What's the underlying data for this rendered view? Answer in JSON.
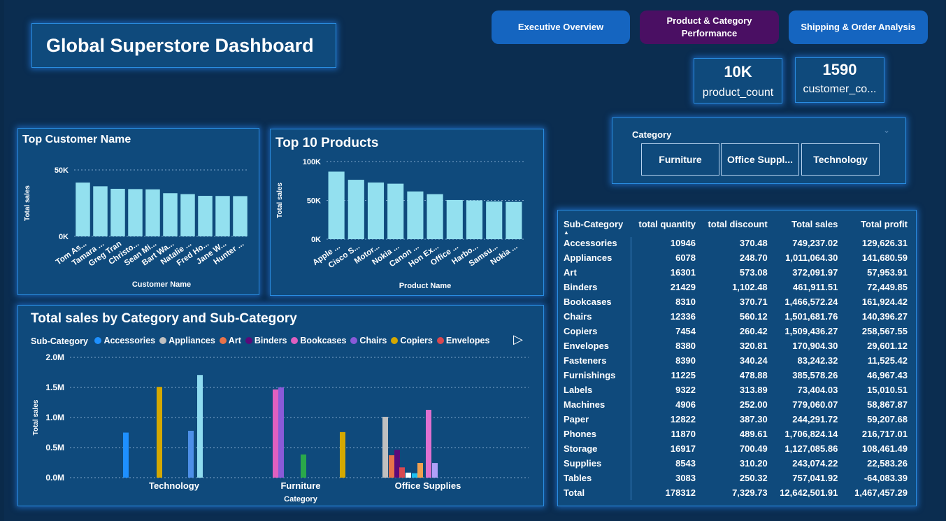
{
  "dashboard_title": "Global Superstore Dashboard",
  "nav": [
    {
      "label": "Executive Overview",
      "color": "#1565c0"
    },
    {
      "label": "Product & Category Performance",
      "color": "#4a0f63"
    },
    {
      "label": "Shipping & Order Analysis",
      "color": "#1565c0"
    }
  ],
  "kpis": {
    "product_count": {
      "value": "10K",
      "label": "product_count"
    },
    "customer_count": {
      "value": "1590",
      "label": "customer_co..."
    }
  },
  "slicer": {
    "label": "Category",
    "options": [
      "Furniture",
      "Office Suppl...",
      "Technology"
    ]
  },
  "top_customers": {
    "title": "Top Customer Name",
    "xlabel": "Customer Name",
    "ylabel": "Total sales",
    "ticks": [
      "50K",
      "0K"
    ],
    "chart_data": {
      "type": "bar",
      "categories": [
        "Tom As...",
        "Tamara ...",
        "Greg Tran",
        "Christo...",
        "Sean Mi...",
        "Bart Wa...",
        "Natalie ...",
        "Fred Ho...",
        "Jane W...",
        "Hunter ..."
      ],
      "values": [
        40500,
        37700,
        35800,
        35600,
        35400,
        32500,
        31800,
        30500,
        30400,
        30300
      ],
      "ylim": [
        0,
        50000
      ]
    }
  },
  "top_products": {
    "title": "Top 10 Products",
    "xlabel": "Product Name",
    "ylabel": "Total sales",
    "ticks": [
      "100K",
      "50K",
      "0K"
    ],
    "chart_data": {
      "type": "bar",
      "categories": [
        "Apple ...",
        "Cisco S...",
        "Motor...",
        "Nokia ...",
        "Canon ...",
        "Hon Ex...",
        "Office ...",
        "Harbo...",
        "Samsu...",
        "Nokia ..."
      ],
      "values": [
        87000,
        76500,
        73000,
        71500,
        61500,
        58000,
        50500,
        50000,
        48500,
        48000
      ],
      "ylim": [
        0,
        100000
      ]
    }
  },
  "category_chart": {
    "title": "Total sales by Category and Sub-Category",
    "legend_title": "Sub-Category",
    "legend": [
      {
        "name": "Accessories",
        "color": "#1e90ff"
      },
      {
        "name": "Appliances",
        "color": "#c0c0c0"
      },
      {
        "name": "Art",
        "color": "#e8734a"
      },
      {
        "name": "Binders",
        "color": "#5b0a7a"
      },
      {
        "name": "Bookcases",
        "color": "#e060c0"
      },
      {
        "name": "Chairs",
        "color": "#8a5ad8"
      },
      {
        "name": "Copiers",
        "color": "#d4a800"
      },
      {
        "name": "Envelopes",
        "color": "#d84850"
      }
    ],
    "xlabel": "Category",
    "ylabel": "Total sales",
    "ticks": [
      "2.0M",
      "1.5M",
      "1.0M",
      "0.5M",
      "0.0M"
    ],
    "chart_data": {
      "type": "bar",
      "categories": [
        "Technology",
        "Furniture",
        "Office Supplies"
      ],
      "ylim": [
        0,
        2000000
      ],
      "series": [
        {
          "category": "Technology",
          "bars": [
            {
              "sub": "Accessories",
              "value": 749237,
              "color": "#1e90ff"
            },
            {
              "sub": "Copiers",
              "value": 1509436,
              "color": "#d4a800"
            },
            {
              "sub": "Machines",
              "value": 779060,
              "color": "#4d8fe8"
            },
            {
              "sub": "Phones",
              "value": 1706824,
              "color": "#8fdcf0"
            }
          ]
        },
        {
          "category": "Furniture",
          "bars": [
            {
              "sub": "Bookcases",
              "value": 1466572,
              "color": "#e060c0"
            },
            {
              "sub": "Chairs",
              "value": 1501682,
              "color": "#8a5ad8"
            },
            {
              "sub": "Furnishings",
              "value": 385578,
              "color": "#2aa84a"
            },
            {
              "sub": "Tables",
              "value": 757042,
              "color": "#d4a800"
            }
          ]
        },
        {
          "category": "Office Supplies",
          "bars": [
            {
              "sub": "Appliances",
              "value": 1011064,
              "color": "#c0c0c0"
            },
            {
              "sub": "Art",
              "value": 372092,
              "color": "#e8734a"
            },
            {
              "sub": "Binders",
              "value": 461912,
              "color": "#5b0a7a"
            },
            {
              "sub": "Envelopes",
              "value": 170904,
              "color": "#d84850"
            },
            {
              "sub": "Fasteners",
              "value": 83242,
              "color": "#ffffff"
            },
            {
              "sub": "Labels",
              "value": 73404,
              "color": "#1ec0f0"
            },
            {
              "sub": "Paper",
              "value": 244292,
              "color": "#f0a050"
            },
            {
              "sub": "Storage",
              "value": 1127086,
              "color": "#e070d0"
            },
            {
              "sub": "Supplies",
              "value": 243074,
              "color": "#b0a0f8"
            }
          ]
        }
      ]
    }
  },
  "table": {
    "columns": [
      "Sub-Category",
      "total quantity",
      "total discount",
      "Total sales",
      "Total profit"
    ],
    "rows": [
      [
        "Accessories",
        "10946",
        "370.48",
        "749,237.02",
        "129,626.31"
      ],
      [
        "Appliances",
        "6078",
        "248.70",
        "1,011,064.30",
        "141,680.59"
      ],
      [
        "Art",
        "16301",
        "573.08",
        "372,091.97",
        "57,953.91"
      ],
      [
        "Binders",
        "21429",
        "1,102.48",
        "461,911.51",
        "72,449.85"
      ],
      [
        "Bookcases",
        "8310",
        "370.71",
        "1,466,572.24",
        "161,924.42"
      ],
      [
        "Chairs",
        "12336",
        "560.12",
        "1,501,681.76",
        "140,396.27"
      ],
      [
        "Copiers",
        "7454",
        "260.42",
        "1,509,436.27",
        "258,567.55"
      ],
      [
        "Envelopes",
        "8380",
        "320.81",
        "170,904.30",
        "29,601.12"
      ],
      [
        "Fasteners",
        "8390",
        "340.24",
        "83,242.32",
        "11,525.42"
      ],
      [
        "Furnishings",
        "11225",
        "478.88",
        "385,578.26",
        "46,967.43"
      ],
      [
        "Labels",
        "9322",
        "313.89",
        "73,404.03",
        "15,010.51"
      ],
      [
        "Machines",
        "4906",
        "252.00",
        "779,060.07",
        "58,867.87"
      ],
      [
        "Paper",
        "12822",
        "387.30",
        "244,291.72",
        "59,207.68"
      ],
      [
        "Phones",
        "11870",
        "489.61",
        "1,706,824.14",
        "216,717.01"
      ],
      [
        "Storage",
        "16917",
        "700.49",
        "1,127,085.86",
        "108,461.49"
      ],
      [
        "Supplies",
        "8543",
        "310.20",
        "243,074.22",
        "22,583.26"
      ],
      [
        "Tables",
        "3083",
        "250.32",
        "757,041.92",
        "-64,083.39"
      ]
    ],
    "total": [
      "Total",
      "178312",
      "7,329.73",
      "12,642,501.91",
      "1,467,457.29"
    ]
  }
}
